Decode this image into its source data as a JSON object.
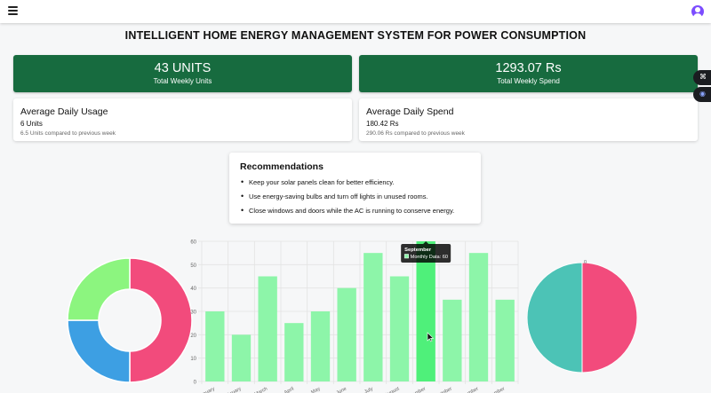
{
  "header": {
    "menu_icon": "hamburger-menu-icon",
    "avatar_icon": "user-avatar-icon",
    "avatar_color": "#7c4dff"
  },
  "page": {
    "title": "INTELLIGENT HOME ENERGY MANAGEMENT SYSTEM FOR POWER CONSUMPTION"
  },
  "stats": {
    "units": {
      "value": "43 UNITS",
      "label": "Total Weekly Units"
    },
    "spend": {
      "value": "1293.07 Rs",
      "label": "Total Weekly Spend"
    },
    "card_color": "#176b3f"
  },
  "usage": {
    "daily_usage": {
      "title": "Average Daily Usage",
      "value": "6 Units",
      "comparison": "6.5 Units compared to previous week"
    },
    "daily_spend": {
      "title": "Average Daily Spend",
      "value": "180.42 Rs",
      "comparison": "290.06 Rs compared to previous week"
    }
  },
  "recommendations": {
    "title": "Recommendations",
    "items": [
      "Keep your solar panels clean for better efficiency.",
      "Use energy-saving bulbs and turn off lights in unused rooms.",
      "Close windows and doors while the AC is running to conserve energy."
    ]
  },
  "side_buttons": {
    "widget_icon": "grid-icon",
    "discord_icon": "discord-icon"
  },
  "chart_data": [
    {
      "type": "pie",
      "variant": "doughnut",
      "values": [
        50,
        25,
        25
      ],
      "colors": [
        "#f24b7c",
        "#3d9fe3",
        "#8cf57f"
      ]
    },
    {
      "type": "bar",
      "categories": [
        "January",
        "February",
        "March",
        "April",
        "May",
        "June",
        "July",
        "August",
        "September",
        "October",
        "November",
        "December"
      ],
      "values": [
        30,
        20,
        45,
        25,
        30,
        40,
        55,
        45,
        60,
        35,
        55,
        35
      ],
      "ylim": [
        0,
        60
      ],
      "yticks": [
        0,
        10,
        20,
        30,
        40,
        50,
        60
      ],
      "grid": true,
      "bar_color": "#8df5a9",
      "highlight_color": "#4ff07a",
      "highlight_index": 8,
      "tooltip": {
        "title": "September",
        "label": "Monthly Data: 60",
        "swatch_color": "#8df5a9"
      }
    },
    {
      "type": "pie",
      "variant": "polar",
      "values": [
        50,
        50
      ],
      "colors": [
        "#f24b7c",
        "#4cc3b6"
      ],
      "ticks": [
        "0"
      ]
    }
  ]
}
